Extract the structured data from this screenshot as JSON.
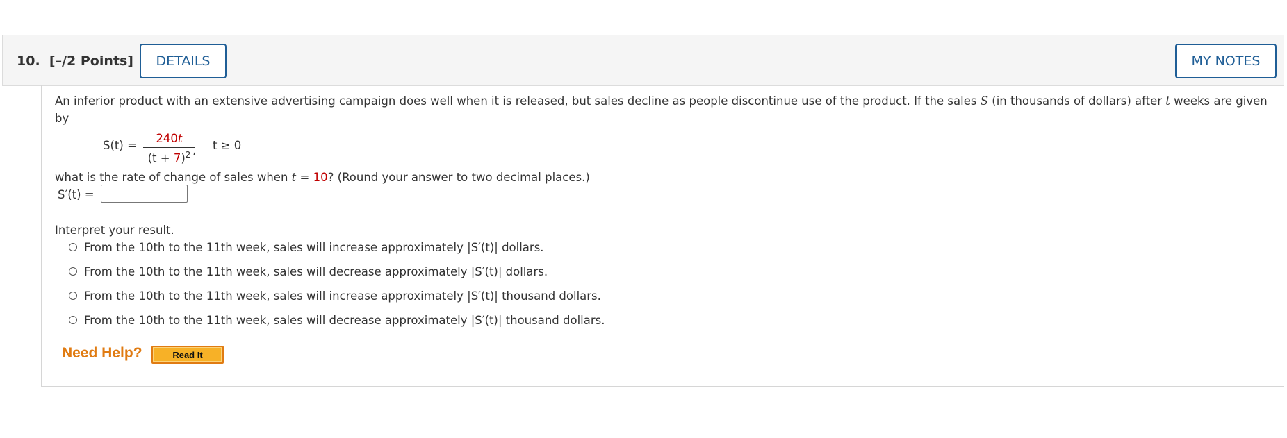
{
  "question": {
    "number_label": "10.",
    "points_label": "[–/2 Points]",
    "details_label": "DETAILS",
    "my_notes_label": "MY NOTES"
  },
  "problem": {
    "intro_line1_a": "An inferior product with an extensive advertising campaign does well when it is released, but sales decline as people discontinue use of the product. If the sales ",
    "intro_var_S": "S",
    "intro_line1_b": " (in thousands of dollars) after ",
    "intro_var_t": "t",
    "intro_line1_c": " weeks are given",
    "intro_line2": "by",
    "formula_lhs": "S(t) =",
    "formula_num_coeff": "240",
    "formula_num_var": "t",
    "formula_den_a": "(t + ",
    "formula_den_7": "7",
    "formula_den_b": ")",
    "formula_den_exp": "2",
    "formula_comma": ",",
    "formula_condition": "t ≥ 0",
    "rate_q_a": "what is the rate of change of sales when ",
    "rate_q_var": "t",
    "rate_q_eq": " = ",
    "rate_q_value": "10",
    "rate_q_b": "?  (Round your answer to two decimal places.)",
    "answer_label": "S′(t) =",
    "answer_value": "",
    "interpret_label": "Interpret your result.",
    "options": [
      "From the 10th to the 11th week, sales will increase approximately |S′(t)| dollars.",
      "From the 10th to the 11th week, sales will decrease approximately |S′(t)| dollars.",
      "From the 10th to the 11th week, sales will increase approximately |S′(t)| thousand dollars.",
      "From the 10th to the 11th week, sales will decrease approximately |S′(t)| thousand dollars."
    ]
  },
  "help": {
    "need_help_label": "Need Help?",
    "read_it_label": "Read It"
  },
  "colors": {
    "accent_blue": "#1f5e96",
    "highlight_red": "#c00000",
    "help_orange": "#e07b12",
    "button_gold": "#f7b127"
  }
}
